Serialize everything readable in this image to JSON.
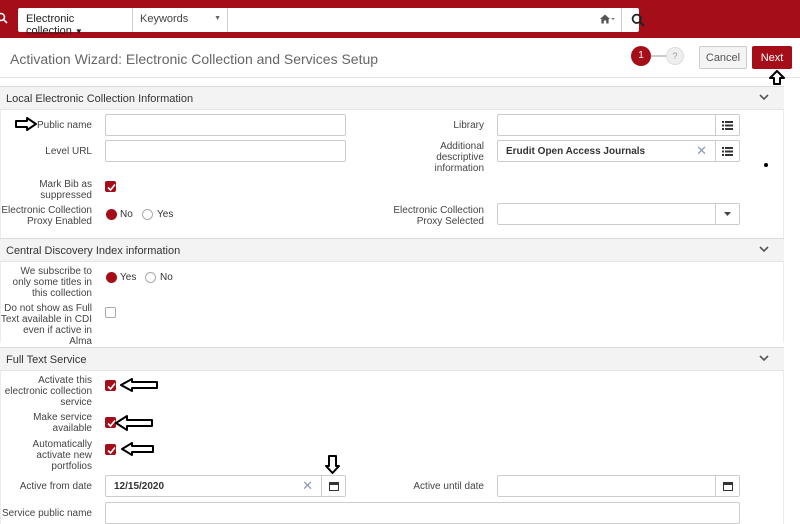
{
  "search": {
    "scope": "Electronic collection",
    "type": "Keywords",
    "query": ""
  },
  "header": {
    "title": "Activation Wizard: Electronic Collection and Services Setup",
    "step_current": "1",
    "step_next": "?",
    "cancel": "Cancel",
    "next": "Next"
  },
  "local": {
    "section_title": "Local Electronic Collection Information",
    "public_name_label": "Public name",
    "public_name_value": "",
    "level_url_label": "Level URL",
    "level_url_value": "",
    "mark_bib_label": "Mark Bib as suppressed",
    "mark_bib_checked": true,
    "proxy_enabled_label": "Electronic Collection Proxy Enabled",
    "proxy_enabled_no": "No",
    "proxy_enabled_yes": "Yes",
    "proxy_enabled_selected": "No",
    "library_label": "Library",
    "library_value": "",
    "additional_label": "Additional descriptive information",
    "additional_value": "Erudit Open Access Journals",
    "proxy_selected_label": "Electronic Collection Proxy Selected",
    "proxy_selected_value": ""
  },
  "cdi": {
    "section_title": "Central Discovery Index information",
    "subscribe_label": "We subscribe to only some titles in this collection",
    "subscribe_yes": "Yes",
    "subscribe_no": "No",
    "subscribe_selected": "Yes",
    "no_fulltext_label": "Do not show as Full Text available in CDI even if active in Alma",
    "no_fulltext_checked": false
  },
  "fulltext": {
    "section_title": "Full Text Service",
    "activate_label": "Activate this electronic collection service",
    "activate_checked": true,
    "make_available_label": "Make service available",
    "make_available_checked": true,
    "auto_activate_label": "Automatically activate new portfolios",
    "auto_activate_checked": true,
    "active_from_label": "Active from date",
    "active_from_value": "12/15/2020",
    "active_until_label": "Active until date",
    "active_until_value": "",
    "service_public_name_label": "Service public name",
    "service_public_name_value": ""
  },
  "colors": {
    "brand": "#a50d18",
    "section_bg": "#f3f3f3",
    "clear_icon": "#8a9ab8"
  },
  "icons": {
    "search": "search-icon",
    "home": "home-icon",
    "list": "list-icon",
    "calendar": "calendar-icon",
    "clear": "clear-icon",
    "chevron": "chevron-down-icon",
    "annotation": "arrow-annotation-icon"
  }
}
